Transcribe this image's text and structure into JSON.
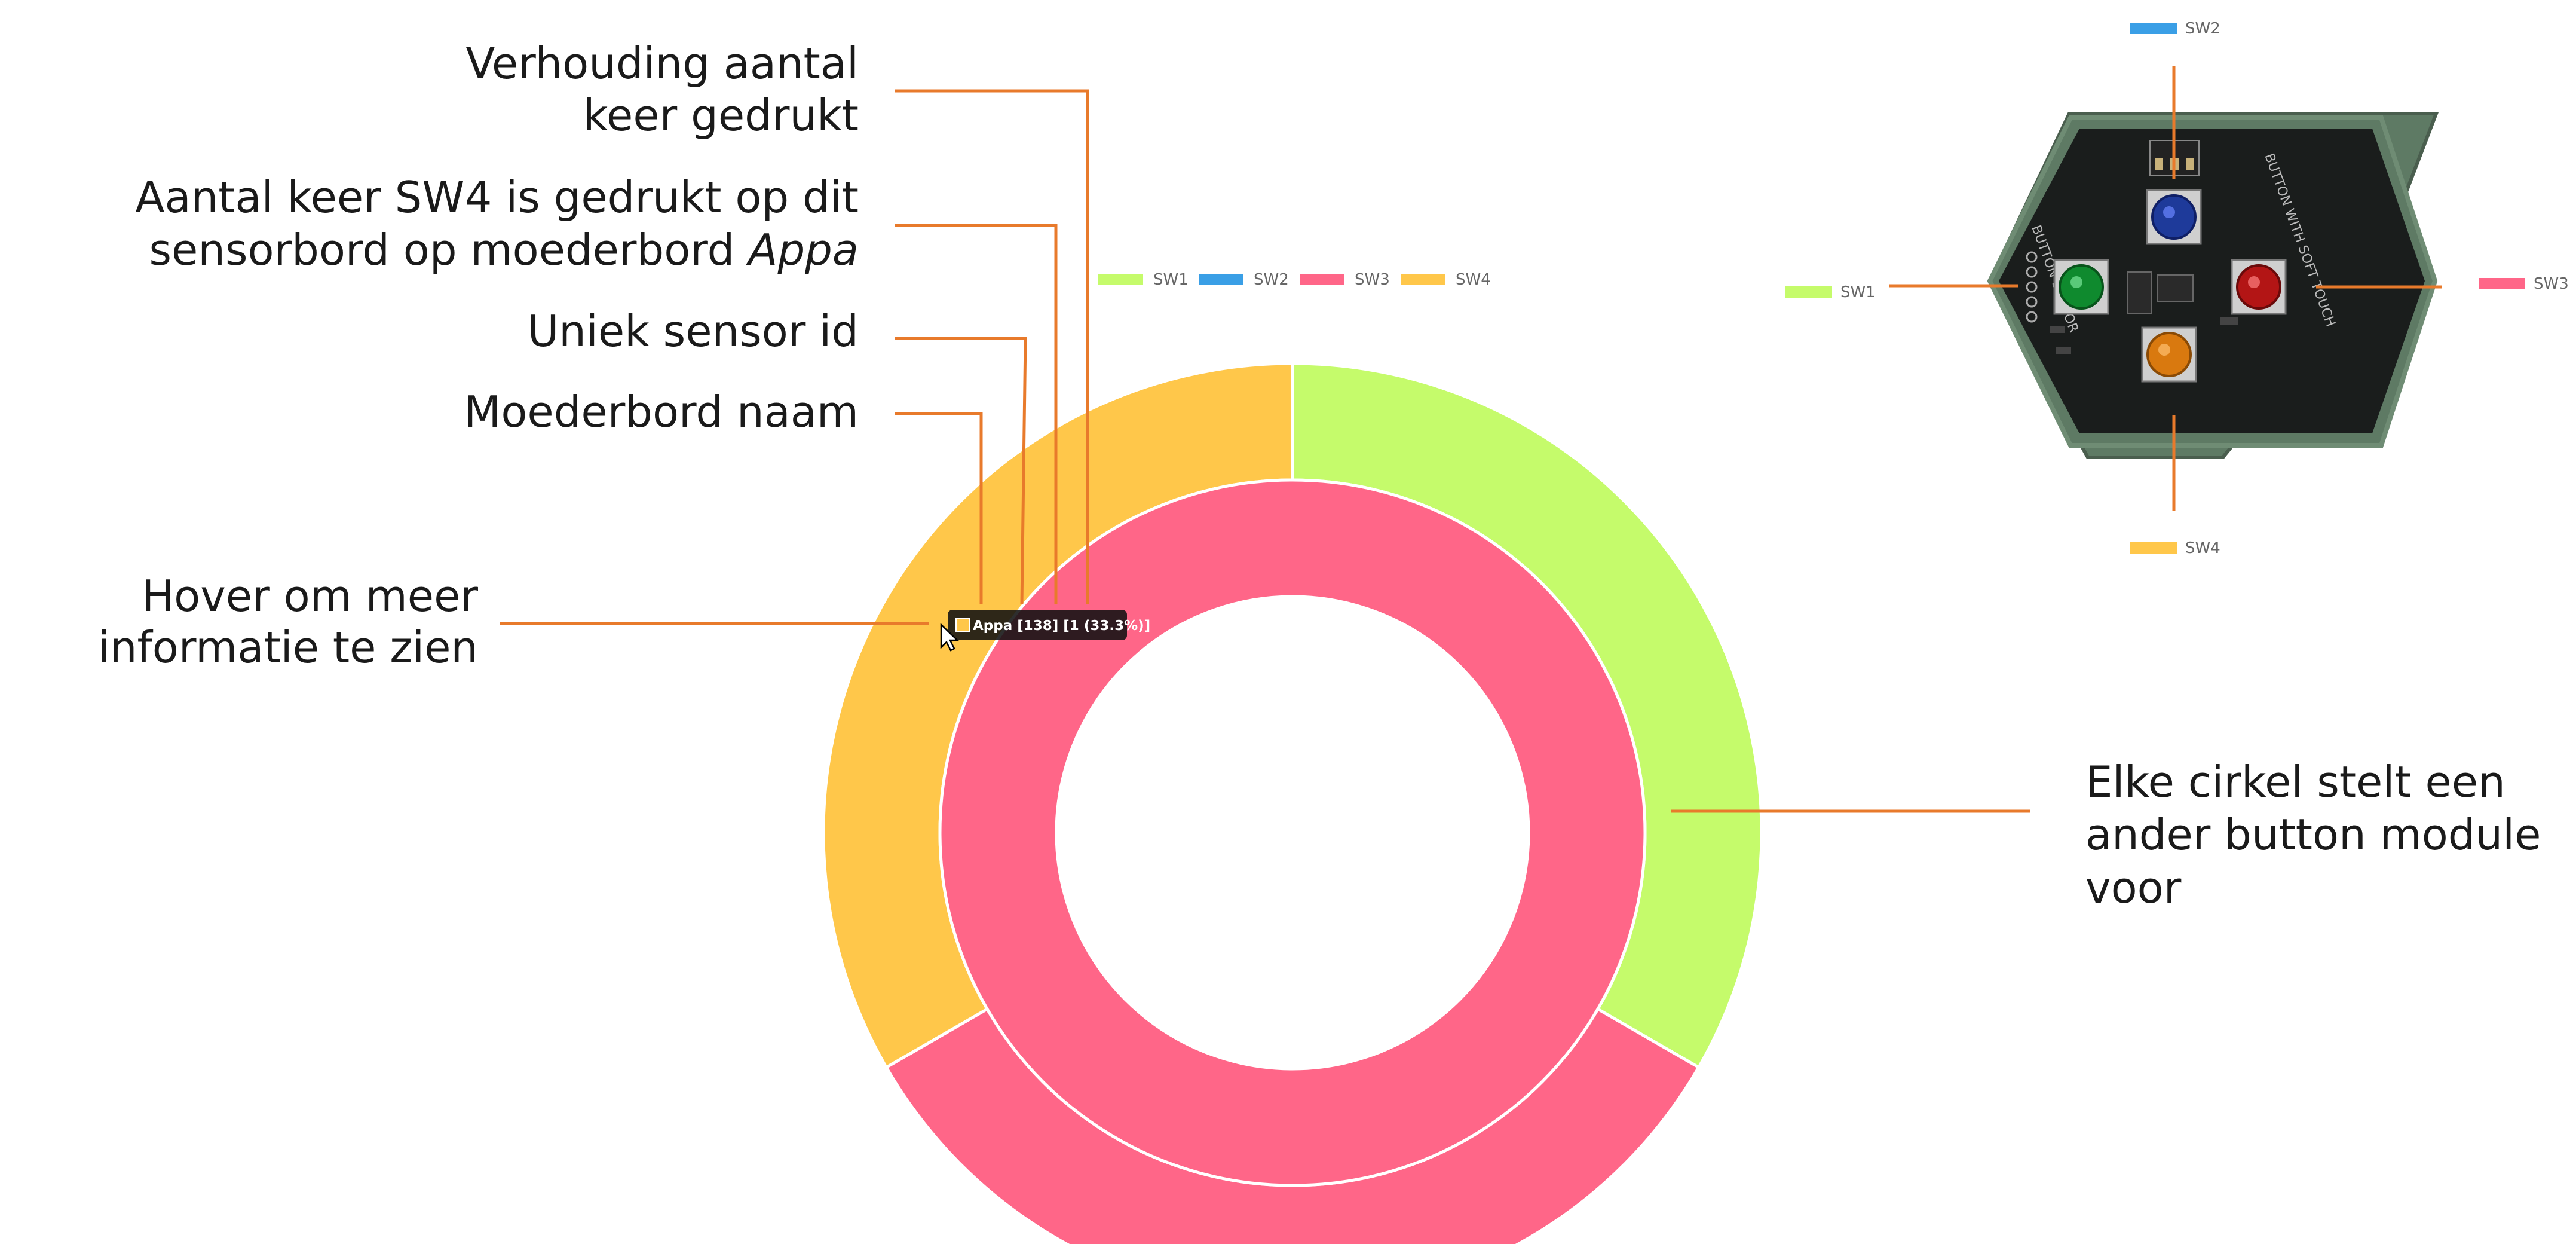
{
  "annotations": {
    "verhouding": [
      "Verhouding aantal",
      "keer gedrukt"
    ],
    "aantal_keer": [
      "Aantal keer SW4 is gedrukt op dit",
      "sensorbord op moederbord "
    ],
    "aantal_keer_italic": "Appa",
    "uniek": "Uniek sensor id",
    "moederbord": "Moederbord naam",
    "hover": [
      "Hover om meer",
      "informatie te zien"
    ],
    "elke": [
      "Elke cirkel stelt een",
      "ander button module",
      "voor"
    ]
  },
  "tooltip": {
    "text": "Appa [138] [1 (33.3%)]"
  },
  "legend": {
    "items": [
      "SW1",
      "SW2",
      "SW3",
      "SW4"
    ]
  },
  "board": {
    "labels": {
      "top": "SW2",
      "left": "SW1",
      "right": "SW3",
      "bottom": "SW4"
    },
    "silkscreen_left": "BUTTON SENSOR",
    "silkscreen_right": "BUTTON WITH SOFT TOUCH"
  },
  "colors": {
    "SW1": "#c5fb6b",
    "SW2": "#3a9fe6",
    "SW3": "#ff6688",
    "SW4": "#ffc74a",
    "leader": "#e87a2b"
  },
  "chart_data": {
    "type": "pie",
    "subtype": "donut",
    "series": [
      {
        "values": [
          1,
          0,
          1,
          1
        ],
        "categories": [
          "SW1",
          "SW2",
          "SW3",
          "SW4"
        ]
      },
      {
        "values": [
          0,
          0,
          1,
          0
        ],
        "categories": [
          "SW1",
          "SW2",
          "SW3",
          "SW4"
        ]
      }
    ],
    "legend_position": "top"
  }
}
